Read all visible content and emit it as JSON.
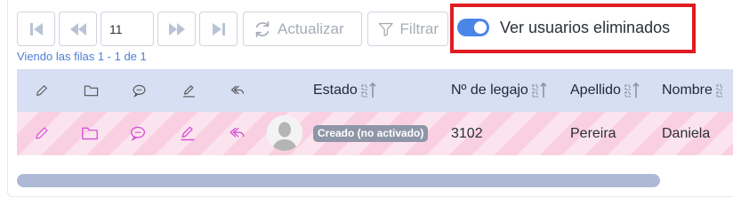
{
  "pagination": {
    "current_page": "11"
  },
  "toolbar": {
    "refresh_label": "Actualizar",
    "filter_label": "Filtrar",
    "show_deleted_label": "Ver usuarios eliminados",
    "show_deleted_enabled": true
  },
  "rows_info": "Viendo las filas 1 - 1 de 1",
  "table": {
    "action_icons": [
      "pencil-icon",
      "folder-icon",
      "comment-icon",
      "signature-icon",
      "reply-icon"
    ],
    "columns": [
      "Estado",
      "Nº de legajo",
      "Apellido",
      "Nombre"
    ],
    "rows": [
      {
        "avatar": "user-avatar",
        "status": "Creado (no activado)",
        "legajo": "3102",
        "apellido": "Pereira",
        "nombre": "Daniela"
      }
    ]
  },
  "colors": {
    "header_bg": "#d6dff3",
    "row_stripe_a": "#fce4ee",
    "row_stripe_b": "#f9d0e1",
    "row_icon": "#d44fd6",
    "toggle_on": "#4a86e8",
    "highlight_border": "#e01b22",
    "link_blue": "#4f7fd6"
  }
}
